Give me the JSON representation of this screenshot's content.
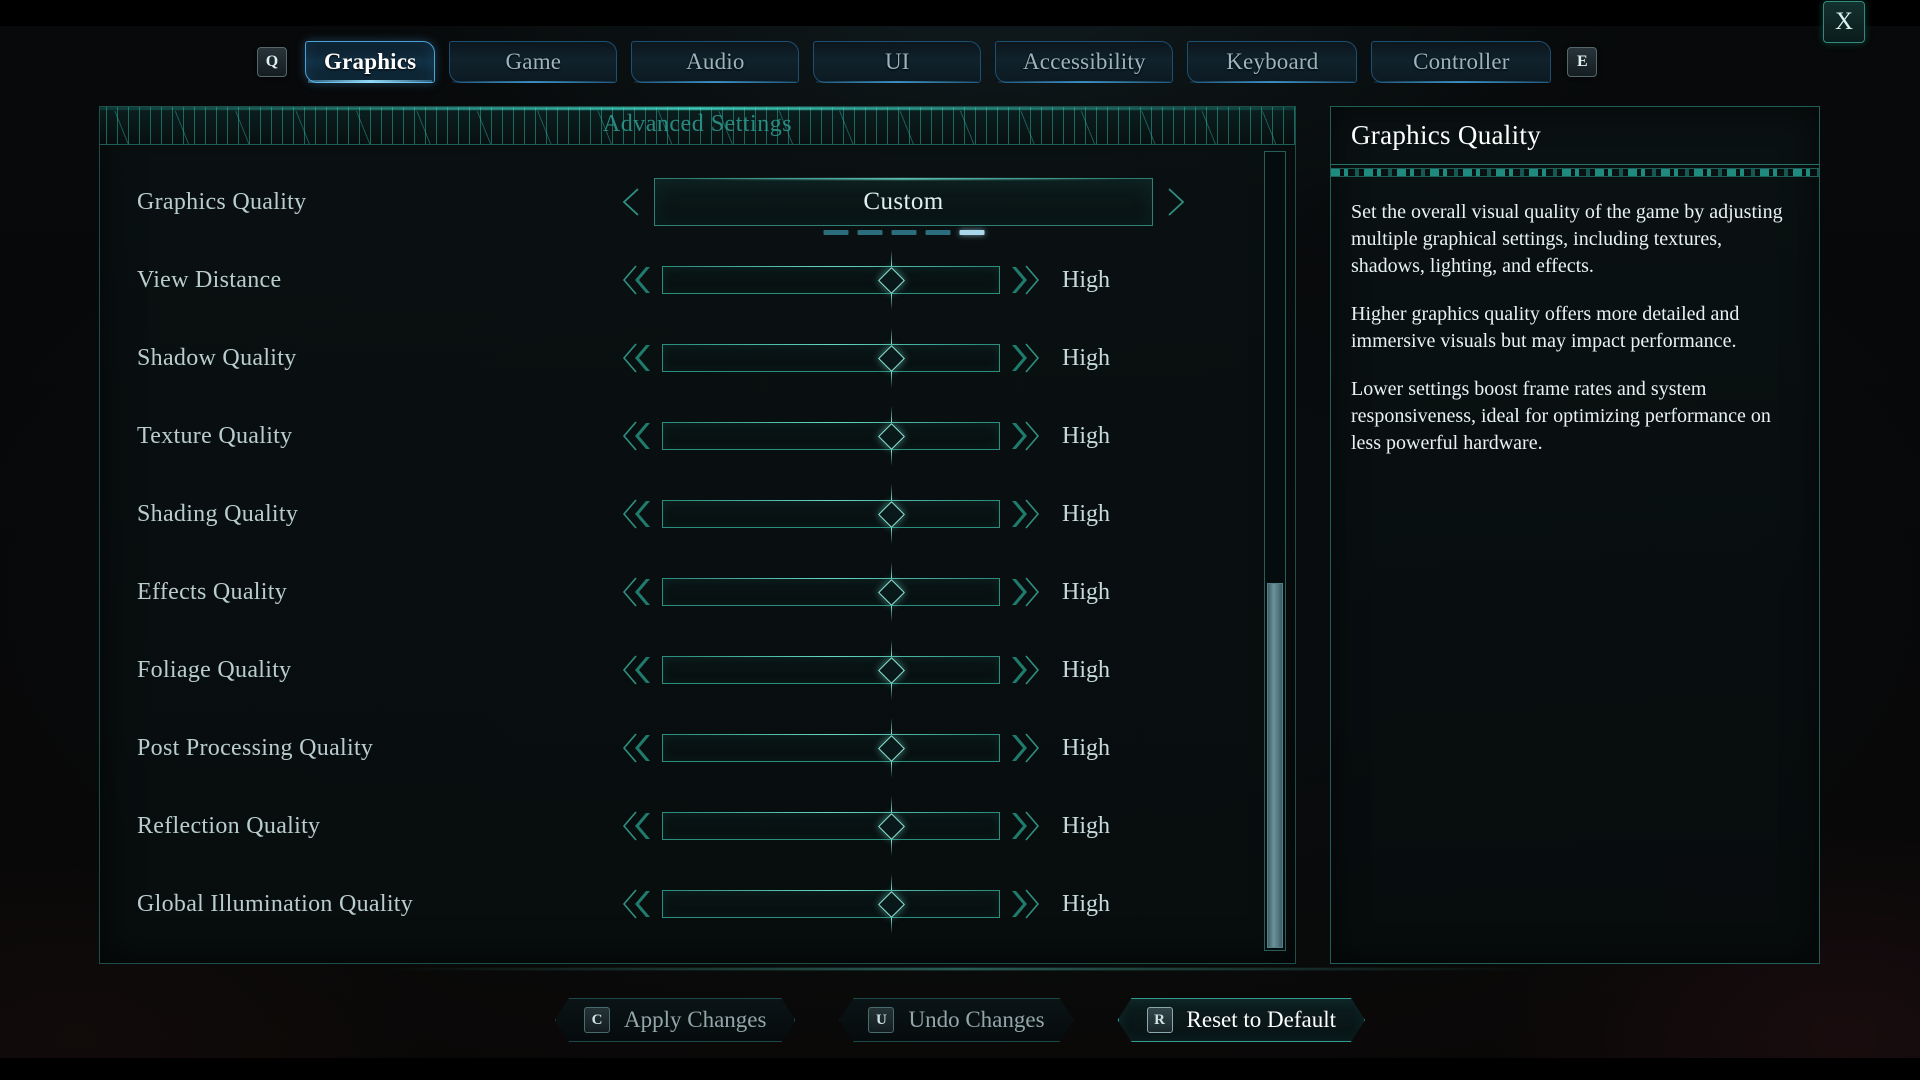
{
  "tabbar": {
    "prev_key": "Q",
    "next_key": "E",
    "close_label": "X",
    "tabs": [
      {
        "label": "Graphics",
        "active": true
      },
      {
        "label": "Game",
        "active": false
      },
      {
        "label": "Audio",
        "active": false
      },
      {
        "label": "UI",
        "active": false
      },
      {
        "label": "Accessibility",
        "active": false
      },
      {
        "label": "Keyboard",
        "active": false
      },
      {
        "label": "Controller",
        "active": false
      }
    ]
  },
  "left_panel": {
    "title": "Advanced Settings",
    "dropdown_row": {
      "label": "Graphics Quality",
      "value": "Custom",
      "prev_icon": "chevron-left-icon",
      "next_icon": "chevron-right-icon",
      "steps": 5,
      "active_step": 5
    },
    "slider_rows": [
      {
        "label": "View Distance",
        "value": "High",
        "position": 68
      },
      {
        "label": "Shadow Quality",
        "value": "High",
        "position": 68
      },
      {
        "label": "Texture Quality",
        "value": "High",
        "position": 68
      },
      {
        "label": "Shading Quality",
        "value": "High",
        "position": 68
      },
      {
        "label": "Effects Quality",
        "value": "High",
        "position": 68
      },
      {
        "label": "Foliage Quality",
        "value": "High",
        "position": 68
      },
      {
        "label": "Post Processing Quality",
        "value": "High",
        "position": 68
      },
      {
        "label": "Reflection Quality",
        "value": "High",
        "position": 68
      },
      {
        "label": "Global Illumination Quality",
        "value": "High",
        "position": 68
      }
    ],
    "scroll_thumb_top_pct": 54
  },
  "right_panel": {
    "title": "Graphics Quality",
    "paragraphs": [
      "Set the overall visual quality of the game by adjusting multiple graphical settings, including textures, shadows, lighting, and effects.",
      "Higher graphics quality offers more detailed and immersive visuals but may impact performance.",
      "Lower settings boost frame rates and system responsiveness, ideal for optimizing performance on less powerful hardware."
    ]
  },
  "bottom_bar": {
    "buttons": [
      {
        "key": "C",
        "label": "Apply Changes",
        "active": false
      },
      {
        "key": "U",
        "label": "Undo Changes",
        "active": false
      },
      {
        "key": "R",
        "label": "Reset to Default",
        "active": true
      }
    ]
  },
  "colors": {
    "accent_teal": "#2f9d91",
    "accent_blue": "#4aa3d8",
    "text_primary": "#ffffff",
    "text_muted": "#93a7aa"
  }
}
